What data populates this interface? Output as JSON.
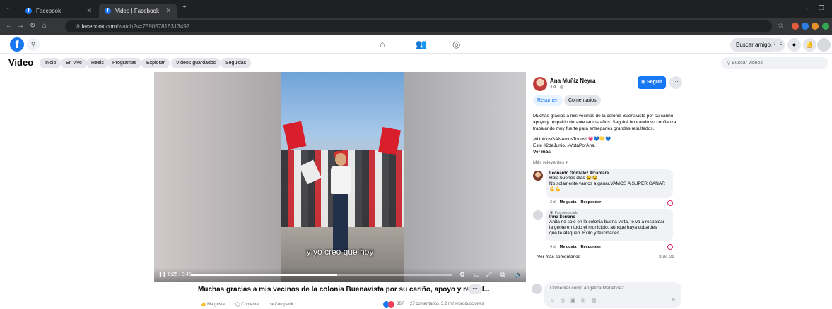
{
  "browser": {
    "tabs": [
      {
        "label": "Facebook",
        "active": false
      },
      {
        "label": "Video | Facebook",
        "active": true
      }
    ],
    "new_tab": "+",
    "url_host": "facebook.com",
    "url_path": "/watch?v=759057816313492",
    "window_minimize": "–",
    "window_restore": "❐"
  },
  "fb_header": {
    "logo": "f",
    "buscar_amigos": "Buscar amigos"
  },
  "video_nav": {
    "title": "Video",
    "pills": [
      "Inicio",
      "En vivo",
      "Reels",
      "Programas",
      "Explorar",
      "Videos guardados",
      "Seguidas"
    ],
    "search_placeholder": "Buscar videos"
  },
  "player": {
    "subtitle": "y yo creo que hoy",
    "time": "0:25 / 0:45",
    "progress_fraction": 0.56
  },
  "video_meta": {
    "caption": "Muchas gracias a mis vecinos de la colonia Buenavista por su cariño, apoyo y respal...",
    "more": "···",
    "like": "Me gusta",
    "comment": "Comentar",
    "share": "Compartir",
    "reactions": "367",
    "comments_count": "27 comentarios",
    "views": "3.2 mil reproducciones"
  },
  "post": {
    "author": "Ana Muñiz Neyra",
    "posted": "4 d · ",
    "follow": "Seguir",
    "more": "···",
    "tabs": [
      "Resumen",
      "Comentarios"
    ],
    "description": "Muchas gracias a mis vecinos de la colonia Buenavista por su cariño, apoyo y respaldo durante tantos años. Seguiré honrando su confianza trabajando muy fuerte para entregarles grandes resultados.",
    "hashtag_line1": "¡#UnidosGANAmosTodos! 💗💙💛💙",
    "hashtag_line2": "Este #2deJunio, #VotaPorAna.",
    "ver_mas": "Ver más",
    "relevant": "Más relevantes ▾",
    "comments": [
      {
        "name": "Leonardo Gonzalez Alcantara",
        "text1": "Hola buenos días 😂😂",
        "text2": "No solamente vamos a ganar.VAMOS A SÚPER GANAR",
        "text3": "💪💪",
        "time": "3 d",
        "like": "Me gusta",
        "reply": "Responder"
      },
      {
        "badge": "🛡 Fan destacado",
        "name": "Irma Serrano",
        "text1": "Anita no solo en la colonia buena vista, te va a respaldar",
        "text2": "la gente en todo el municipio, aunque haya cobardes",
        "text3": "que te ataquen. Éxito y felicidades .",
        "time": "4 d",
        "like": "Me gusta",
        "reply": "Responder"
      }
    ],
    "ver_mas_comentarios": "Ver más comentarios",
    "comment_count": "2 de 21",
    "input_placeholder": "Comentar como Angélica Menéndez"
  },
  "colors": {
    "fb_blue": "#1877f2",
    "chrome_dark": "#35363a",
    "pill_gray": "#e4e6eb"
  }
}
